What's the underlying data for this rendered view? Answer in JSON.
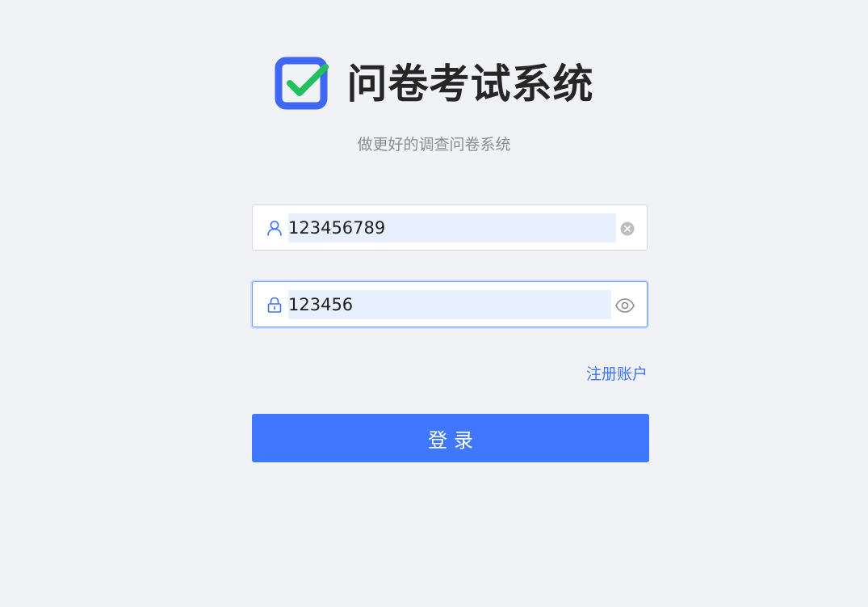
{
  "brand": {
    "title": "问卷考试系统",
    "subtitle": "做更好的调查问卷系统",
    "logo_icon": "checkbox-check-icon",
    "logo_frame_color": "#3f67f3",
    "logo_check_color": "#22c15e"
  },
  "form": {
    "username": {
      "value": "123456789",
      "prefix_icon": "user-icon",
      "suffix_icon": "clear-icon"
    },
    "password": {
      "value": "123456",
      "prefix_icon": "lock-icon",
      "suffix_icon": "eye-icon"
    },
    "register_link": "注册账户",
    "submit_label": "登录"
  },
  "colors": {
    "background": "#f0f2f5",
    "primary": "#3f78ff",
    "link": "#3f74f2",
    "autofill": "#e8f0fe"
  }
}
